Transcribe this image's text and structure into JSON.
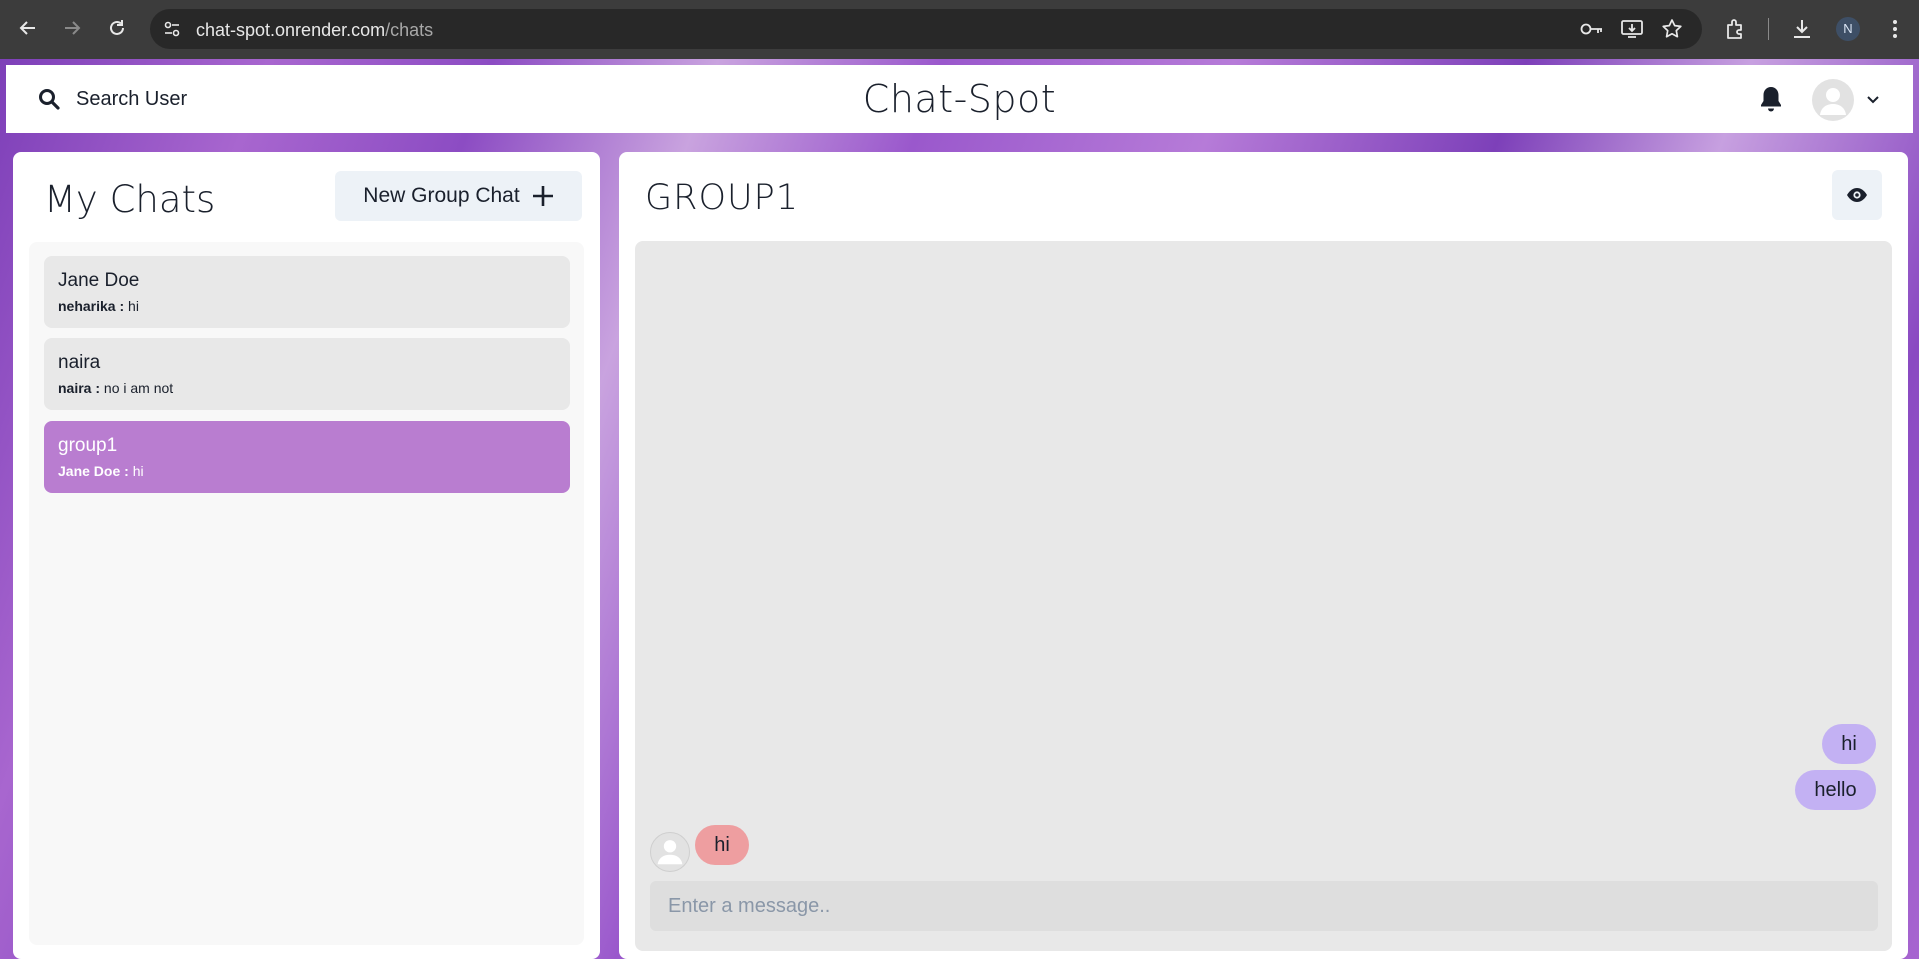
{
  "browser": {
    "url_host": "chat-spot.onrender.com",
    "url_path": "/chats",
    "profile_initial": "N",
    "icons": [
      "back-icon",
      "forward-icon",
      "reload-icon",
      "site-info-icon",
      "password-key-icon",
      "install-app-icon",
      "bookmark-star-icon",
      "extensions-icon",
      "downloads-icon",
      "more-menu-icon"
    ]
  },
  "header": {
    "search_label": "Search User",
    "brand": "Chat-Spot"
  },
  "sidebar": {
    "title": "My Chats",
    "new_group_label": "New Group Chat",
    "chats": [
      {
        "name": "Jane Doe",
        "sender": "neharika :",
        "last": "hi",
        "active": false
      },
      {
        "name": "naira",
        "sender": "naira :",
        "last": "no i am not",
        "active": false
      },
      {
        "name": "group1",
        "sender": "Jane Doe :",
        "last": "hi",
        "active": true
      }
    ]
  },
  "chat": {
    "title": "GROUP1",
    "messages": [
      {
        "text": "hi",
        "mine": true
      },
      {
        "text": "hello",
        "mine": true
      },
      {
        "text": "hi",
        "mine": false
      }
    ],
    "input_placeholder": "Enter a message.."
  },
  "colors": {
    "active_chat": "#b97dd0",
    "my_bubble": "#c3b1f3",
    "their_bubble": "#ee9ea0"
  }
}
